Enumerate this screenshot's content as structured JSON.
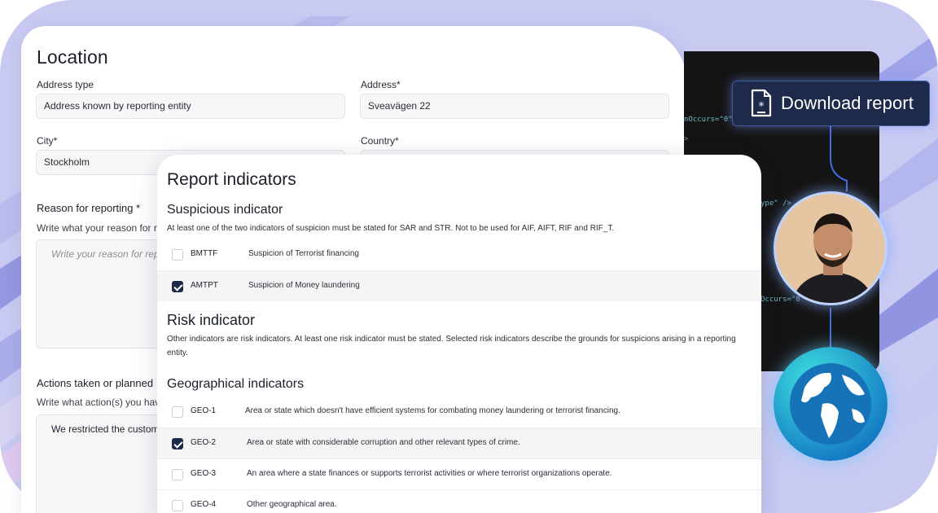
{
  "location": {
    "title": "Location",
    "address_type_label": "Address type",
    "address_type_value": "Address known by reporting entity",
    "address_label": "Address*",
    "address_value": "Sveavägen 22",
    "city_label": "City*",
    "city_value": "Stockholm",
    "country_label": "Country*",
    "reason_label": "Reason for reporting *",
    "reason_hint": "Write what your reason for re",
    "reason_placeholder": "Write your reason for rep",
    "actions_label": "Actions taken or planned",
    "actions_hint": "Write what action(s) you hav",
    "actions_value": "We restricted the custom"
  },
  "code_lines": [
    "nOccurs=\"0\"",
    ">",
    "ype\" />",
    "Occurs=\"0"
  ],
  "download": {
    "label": "Download report",
    "icon": "document-icon"
  },
  "report": {
    "title": "Report indicators",
    "suspicious": {
      "title": "Suspicious indicator",
      "description": "At least one of the two indicators of suspicion must be stated for SAR and STR. Not to be used for AIF, AIFT, RIF and RIF_T.",
      "items": [
        {
          "code": "BMTTF",
          "text": "Suspicion of  Terrorist financing",
          "checked": false
        },
        {
          "code": "AMTPT",
          "text": "Suspicion of  Money laundering",
          "checked": true
        }
      ]
    },
    "risk": {
      "title": "Risk indicator",
      "description": "Other indicators are risk indicators. At least one risk indicator must be stated. Selected risk indicators describe the grounds for suspicions arising in a reporting entity."
    },
    "geo": {
      "title": "Geographical indicators",
      "items": [
        {
          "code": "GEO-1",
          "text": "Area or state which doesn't have efficient systems for combating money laundering or terrorist financing.",
          "checked": false
        },
        {
          "code": "GEO-2",
          "text": "Area or state with considerable corruption and other relevant types of crime.",
          "checked": true
        },
        {
          "code": "GEO-3",
          "text": "An area where a state finances or supports terrorist activities or where terrorist organizations operate.",
          "checked": false
        },
        {
          "code": "GEO-4",
          "text": "Other geographical area.",
          "checked": false
        }
      ]
    }
  },
  "colors": {
    "navy": "#1d2a4a",
    "lavender": "#c8caf2",
    "periwinkle": "#8f93e0"
  }
}
